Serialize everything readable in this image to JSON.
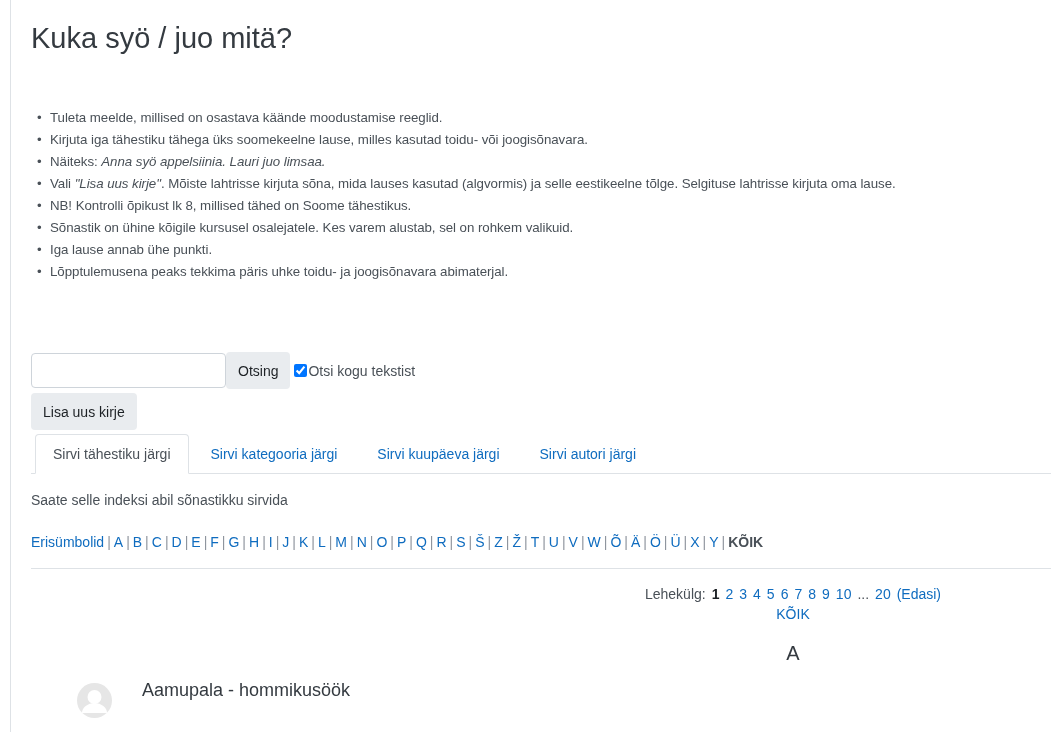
{
  "title": "Kuka syö / juo mitä?",
  "bullet": "•",
  "letter_separator": "|",
  "instructions": [
    "Tuleta meelde, millised on osastava käände moodustamise reeglid.",
    "Kirjuta iga tähestiku tähega üks soomekeelne lause, milles kasutad toidu- või joogisõnavara.",
    "Näiteks: *Anna syö appelsiinia. Lauri juo limsaa.*",
    "Vali *\"Lisa uus kirje\"*. Mõiste lahtrisse kirjuta sõna, mida lauses kasutad (algvormis) ja selle eestikeelne tõlge. Selgituse lahtrisse kirjuta oma lause.",
    "NB! Kontrolli õpikust lk 8, millised tähed on Soome tähestikus.",
    "Sõnastik on ühine kõigile kursusel osalejatele. Kes varem alustab, sel on rohkem valikuid.",
    "Iga lause annab ühe punkti.",
    "Lõpptulemusena peaks tekkima päris uhke toidu- ja joogisõnavara abimaterjal."
  ],
  "search": {
    "button": "Otsing",
    "fulltext": {
      "label": "Otsi kogu tekstist",
      "checked": true
    }
  },
  "add_button": "Lisa uus kirje",
  "tabs": [
    {
      "label": "Sirvi tähestiku järgi",
      "selected": true
    },
    {
      "label": "Sirvi kategooria järgi",
      "selected": false
    },
    {
      "label": "Sirvi kuupäeva järgi",
      "selected": false
    },
    {
      "label": "Sirvi autori järgi",
      "selected": false
    }
  ],
  "index_hint": "Saate selle indeksi abil sõnastikku sirvida",
  "letters": [
    {
      "label": "Erisümbolid",
      "selected": false
    },
    {
      "label": "A",
      "selected": false
    },
    {
      "label": "B",
      "selected": false
    },
    {
      "label": "C",
      "selected": false
    },
    {
      "label": "D",
      "selected": false
    },
    {
      "label": "E",
      "selected": false
    },
    {
      "label": "F",
      "selected": false
    },
    {
      "label": "G",
      "selected": false
    },
    {
      "label": "H",
      "selected": false
    },
    {
      "label": "I",
      "selected": false
    },
    {
      "label": "J",
      "selected": false
    },
    {
      "label": "K",
      "selected": false
    },
    {
      "label": "L",
      "selected": false
    },
    {
      "label": "M",
      "selected": false
    },
    {
      "label": "N",
      "selected": false
    },
    {
      "label": "O",
      "selected": false
    },
    {
      "label": "P",
      "selected": false
    },
    {
      "label": "Q",
      "selected": false
    },
    {
      "label": "R",
      "selected": false
    },
    {
      "label": "S",
      "selected": false
    },
    {
      "label": "Š",
      "selected": false
    },
    {
      "label": "Z",
      "selected": false
    },
    {
      "label": "Ž",
      "selected": false
    },
    {
      "label": "T",
      "selected": false
    },
    {
      "label": "U",
      "selected": false
    },
    {
      "label": "V",
      "selected": false
    },
    {
      "label": "W",
      "selected": false
    },
    {
      "label": "Õ",
      "selected": false
    },
    {
      "label": "Ä",
      "selected": false
    },
    {
      "label": "Ö",
      "selected": false
    },
    {
      "label": "Ü",
      "selected": false
    },
    {
      "label": "X",
      "selected": false
    },
    {
      "label": "Y",
      "selected": false
    },
    {
      "label": "KÕIK",
      "selected": true
    }
  ],
  "pager": {
    "label": "Lehekülg:",
    "pages": [
      {
        "kind": "page",
        "label": "1",
        "selected": true
      },
      {
        "kind": "page",
        "label": "2",
        "selected": false
      },
      {
        "kind": "page",
        "label": "3",
        "selected": false
      },
      {
        "kind": "page",
        "label": "4",
        "selected": false
      },
      {
        "kind": "page",
        "label": "5",
        "selected": false
      },
      {
        "kind": "page",
        "label": "6",
        "selected": false
      },
      {
        "kind": "page",
        "label": "7",
        "selected": false
      },
      {
        "kind": "page",
        "label": "8",
        "selected": false
      },
      {
        "kind": "page",
        "label": "9",
        "selected": false
      },
      {
        "kind": "page",
        "label": "10",
        "selected": false
      },
      {
        "kind": "ellipsis",
        "label": "..."
      },
      {
        "kind": "page",
        "label": "20",
        "selected": false
      },
      {
        "kind": "next",
        "label": "(Edasi)"
      }
    ],
    "all": "KÕIK"
  },
  "section_letter": "A",
  "entries": [
    {
      "title": "Aamupala - hommikusöök"
    }
  ]
}
